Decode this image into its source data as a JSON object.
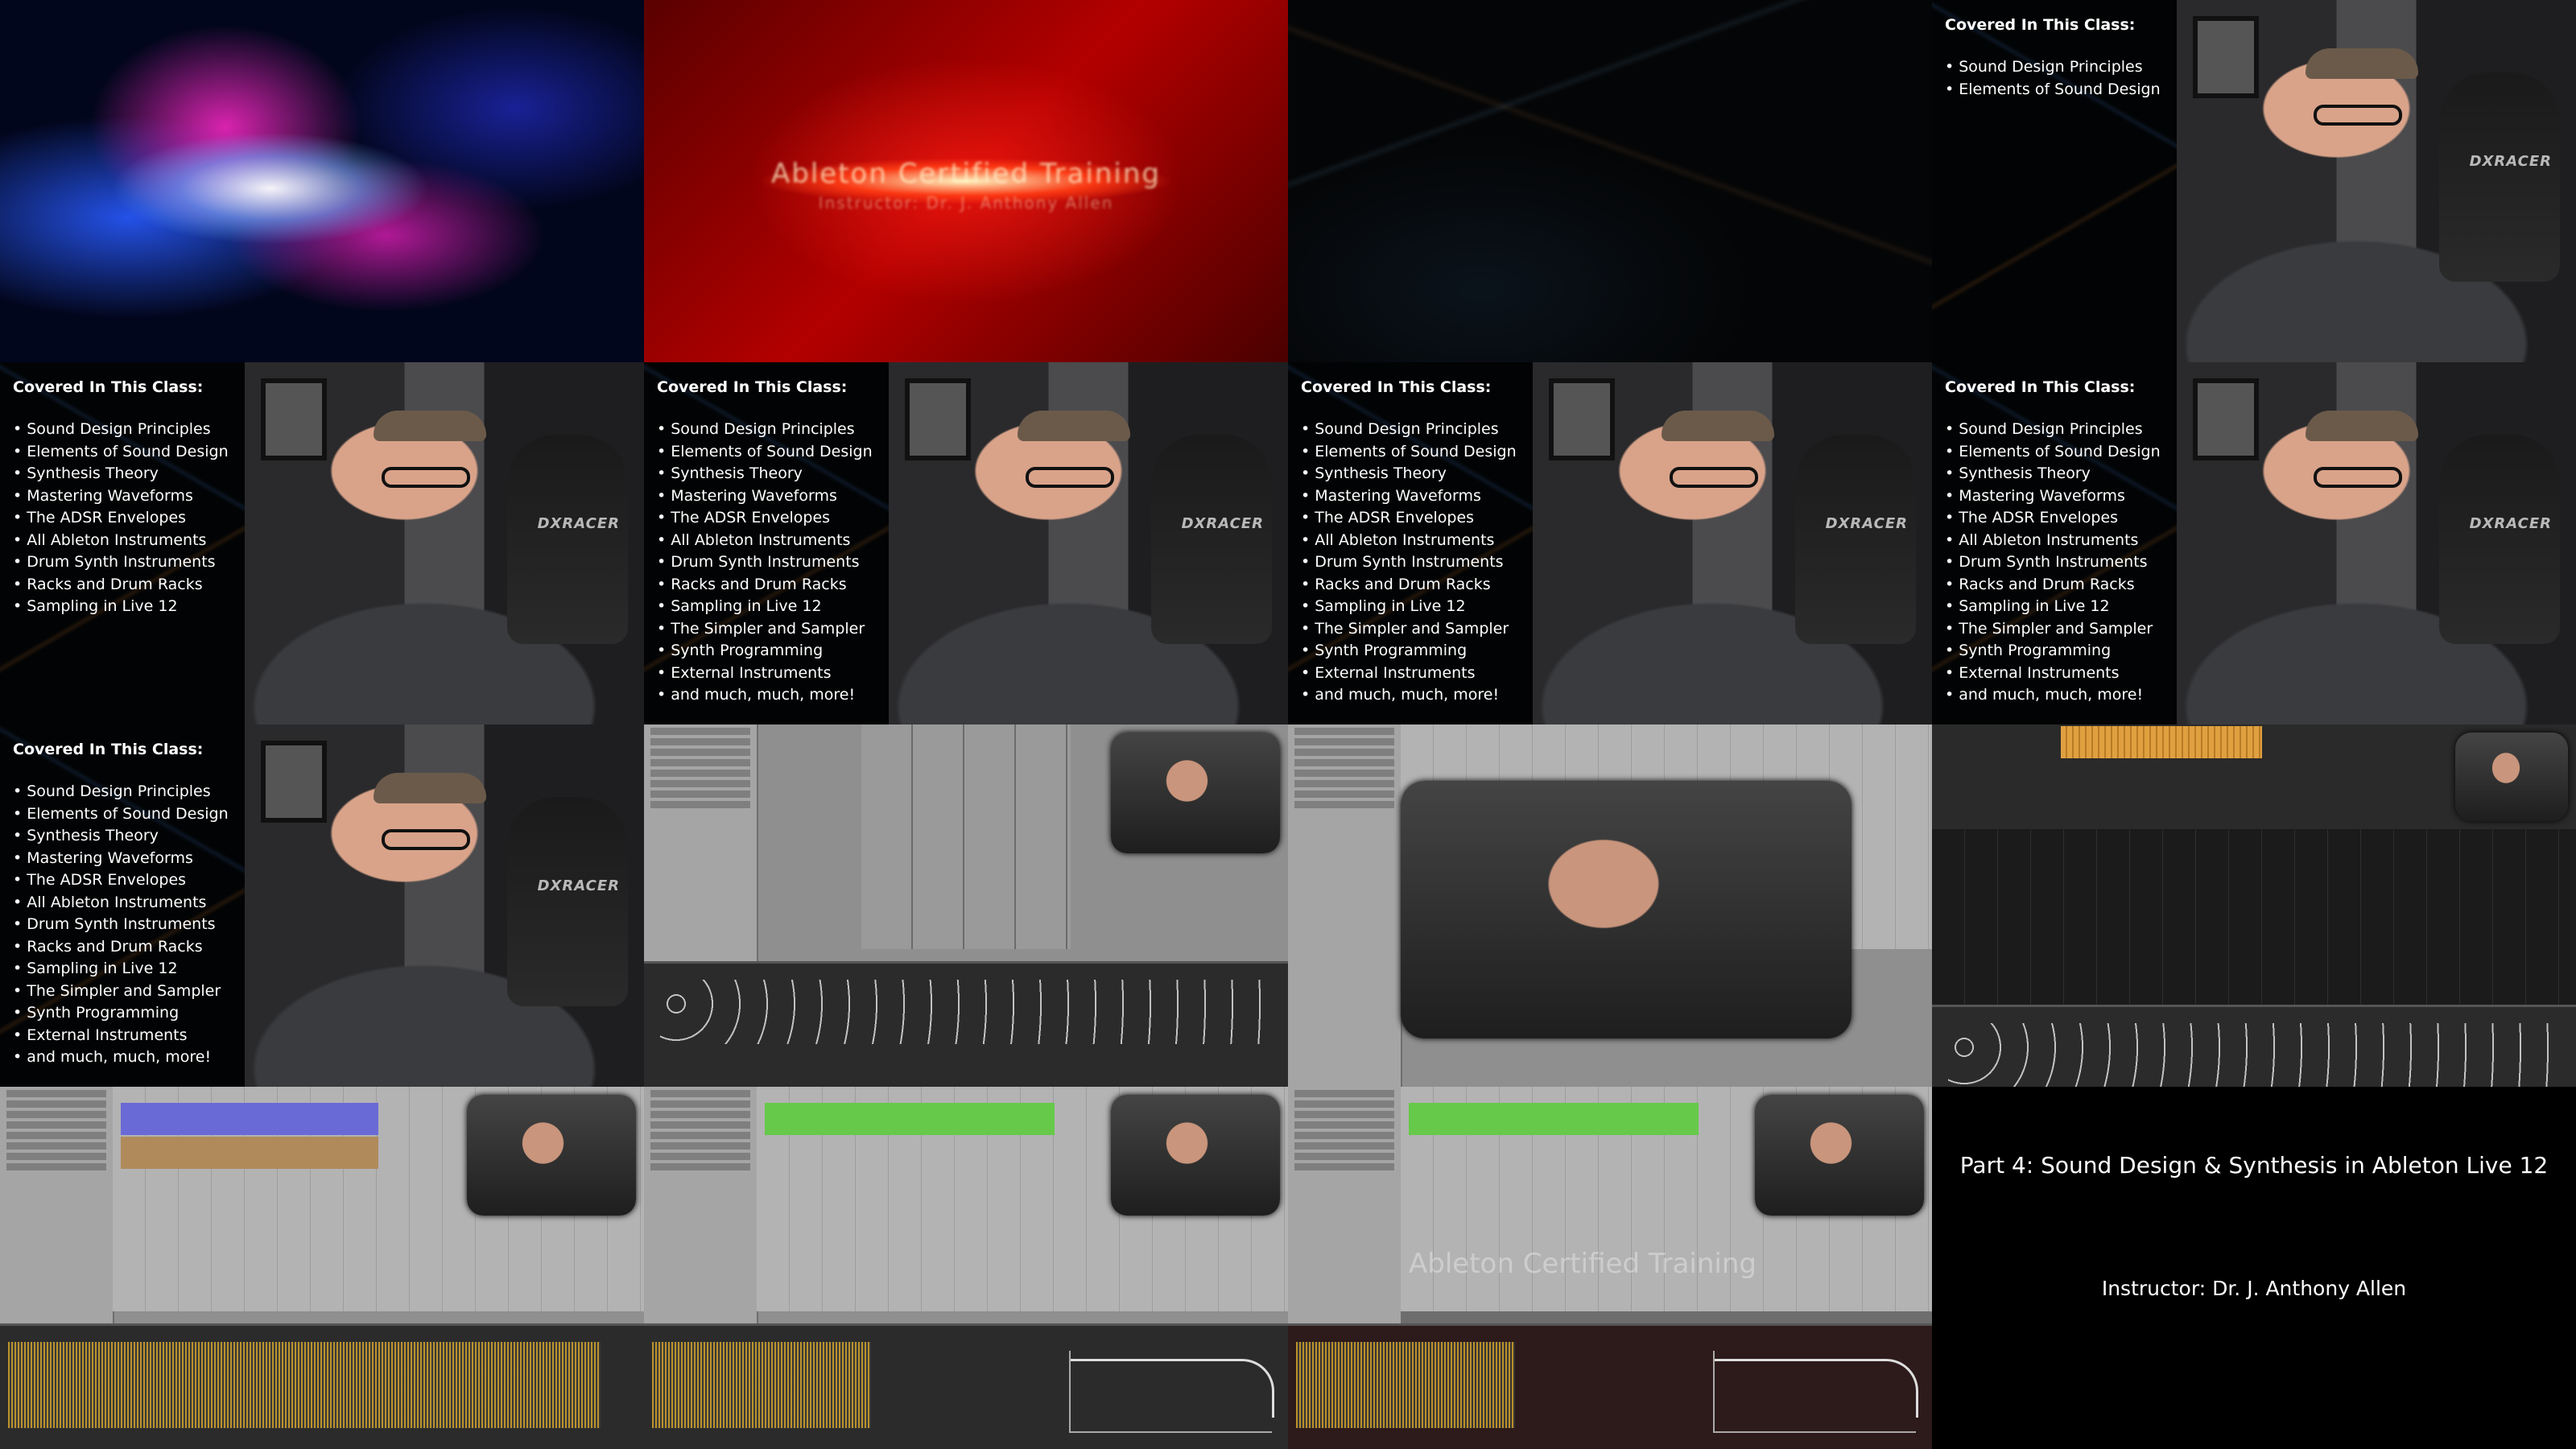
{
  "intro": {
    "ghost_text": "Ableton Certified Training",
    "ghost_sub": "Instructor: Dr. J. Anthony Allen"
  },
  "panel": {
    "heading": "Covered In This Class:",
    "items_short": [
      "Sound Design Principles",
      "Elements of Sound Design"
    ],
    "items_nine": [
      "Sound Design Principles",
      "Elements of Sound Design",
      "Synthesis Theory",
      "Mastering Waveforms",
      "The ADSR Envelopes",
      "All Ableton Instruments",
      "Drum Synth Instruments",
      "Racks and Drum Racks",
      "Sampling in Live 12"
    ],
    "items_full": [
      "Sound Design Principles",
      "Elements of Sound Design",
      "Synthesis Theory",
      "Mastering Waveforms",
      "The ADSR Envelopes",
      "All Ableton Instruments",
      "Drum Synth Instruments",
      "Racks and Drum Racks",
      "Sampling in Live 12",
      "The Simpler and Sampler",
      "Synth Programming",
      "External Instruments",
      "and much, much, more!"
    ]
  },
  "cam": {
    "chair_brand": "DXRACER"
  },
  "watermark": "Ableton Certified Training",
  "title_card": {
    "title": "Part 4: Sound Design & Synthesis in Ableton Live 12",
    "instructor": "Instructor: Dr. J. Anthony Allen"
  }
}
